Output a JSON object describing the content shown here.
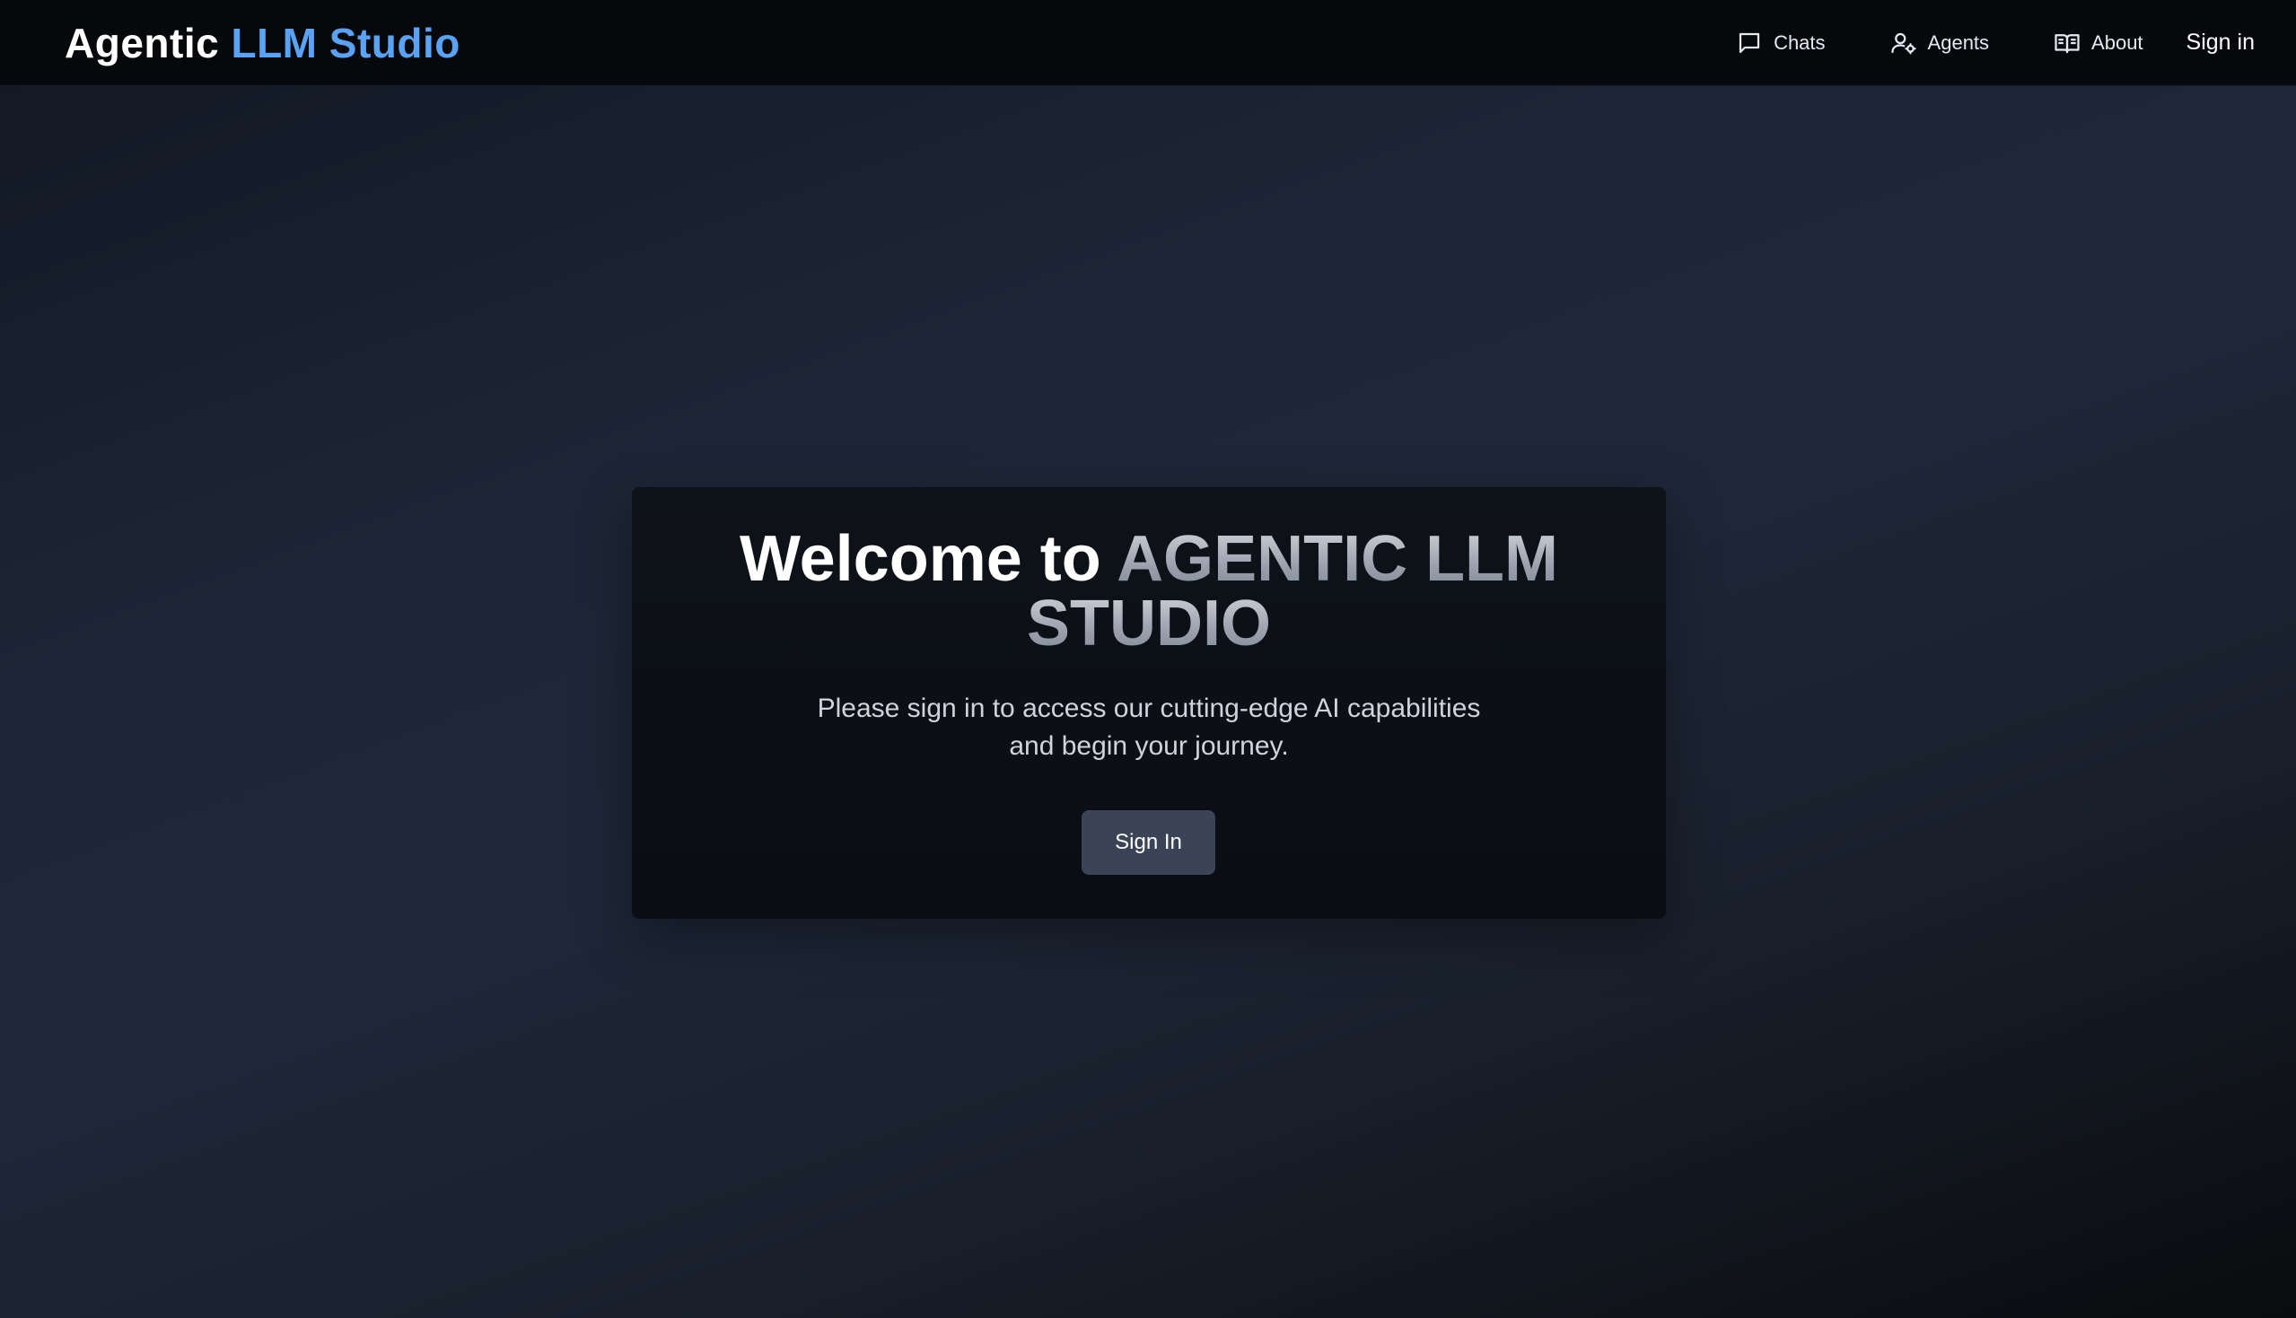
{
  "header": {
    "brand_part1": "Agentic",
    "brand_part2": "LLM Studio",
    "nav": [
      {
        "label": "Chats",
        "icon": "chat-icon"
      },
      {
        "label": "Agents",
        "icon": "user-gear-icon"
      },
      {
        "label": "About",
        "icon": "book-icon"
      }
    ],
    "signin_label": "Sign in"
  },
  "main": {
    "title_lead": "Welcome to",
    "title_brand": "AGENTIC LLM STUDIO",
    "subtitle": "Please sign in to access our cutting-edge AI capabilities and begin your journey.",
    "signin_button": "Sign In"
  },
  "colors": {
    "accent": "#5aa3f4",
    "header_bg": "#06080c",
    "card_bg": "#0e1219",
    "button_bg": "#3a4456"
  }
}
